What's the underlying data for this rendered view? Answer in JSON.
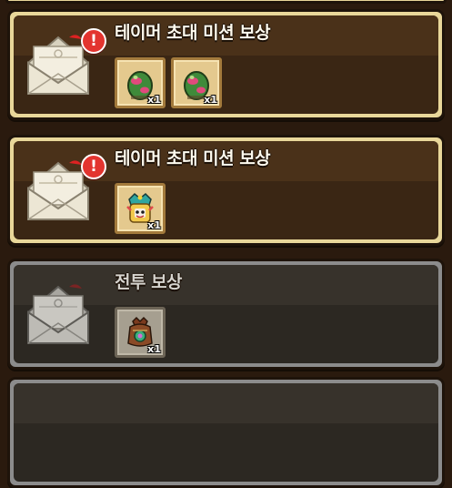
{
  "mail_list": [
    {
      "title": "테이머 초대 미션 보상",
      "unread": true,
      "alert_symbol": "!",
      "disabled": false,
      "rewards": [
        {
          "icon": "green-egg-icon",
          "quantity": "x1"
        },
        {
          "icon": "green-egg-icon",
          "quantity": "x1"
        }
      ]
    },
    {
      "title": "테이머 초대 미션 보상",
      "unread": true,
      "alert_symbol": "!",
      "disabled": false,
      "rewards": [
        {
          "icon": "monster-portrait-icon",
          "quantity": "x1"
        }
      ]
    },
    {
      "title": "전투 보상",
      "unread": false,
      "disabled": true,
      "rewards": [
        {
          "icon": "treasure-pouch-icon",
          "quantity": "x1"
        }
      ]
    }
  ],
  "colors": {
    "card_frame": "#e9d79a",
    "card_body": "#3a2614",
    "alert_red": "#e3342f",
    "item_frame": "#e4c98e"
  }
}
